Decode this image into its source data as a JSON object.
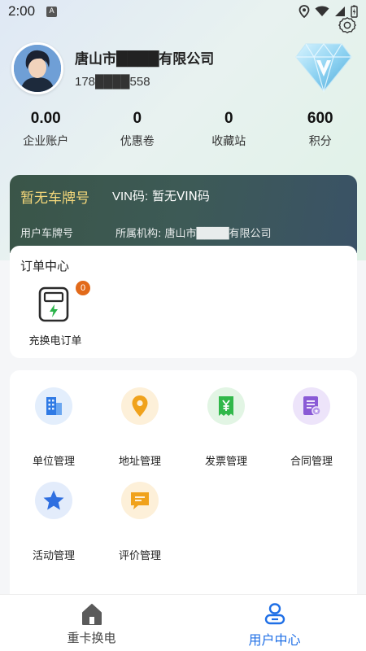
{
  "status": {
    "time": "2:00",
    "a_badge": "A"
  },
  "profile": {
    "company": "唐山市████有限公司",
    "phone": "178████558"
  },
  "stats": [
    {
      "value": "0.00",
      "label": "企业账户"
    },
    {
      "value": "0",
      "label": "优惠卷"
    },
    {
      "value": "0",
      "label": "收藏站"
    },
    {
      "value": "600",
      "label": "积分"
    }
  ],
  "vehicle": {
    "plate": "暂无车牌号",
    "vin_label": "VIN码:",
    "vin_value": "暂无VIN码",
    "plate_label": "用户车牌号",
    "org_label": "所属机构:",
    "org_value": "唐山市████有限公司"
  },
  "orders": {
    "title": "订单中心",
    "items": [
      {
        "label": "充换电订单",
        "badge": "0"
      }
    ]
  },
  "menu": [
    {
      "label": "单位管理",
      "icon": "building-icon",
      "color": "#2f7ae5",
      "bg": "#e3eefc"
    },
    {
      "label": "地址管理",
      "icon": "location-pin-icon",
      "color": "#f0a21c",
      "bg": "#fdf0d9"
    },
    {
      "label": "发票管理",
      "icon": "invoice-yen-icon",
      "color": "#31b84a",
      "bg": "#e2f5e4"
    },
    {
      "label": "合同管理",
      "icon": "contract-icon",
      "color": "#8a5ad6",
      "bg": "#ede4fa"
    },
    {
      "label": "活动管理",
      "icon": "star-icon",
      "color": "#2f6fe0",
      "bg": "#e3ecfb"
    },
    {
      "label": "评价管理",
      "icon": "comment-icon",
      "color": "#f0a21c",
      "bg": "#fdf0d9"
    }
  ],
  "tabs": [
    {
      "label": "重卡换电",
      "icon": "home-icon",
      "active": false
    },
    {
      "label": "用户中心",
      "icon": "user-center-icon",
      "active": true
    }
  ],
  "colors": {
    "accent": "#1f6fe6",
    "plate_gold": "#f4d77a",
    "card_dark": "#3b5650"
  }
}
